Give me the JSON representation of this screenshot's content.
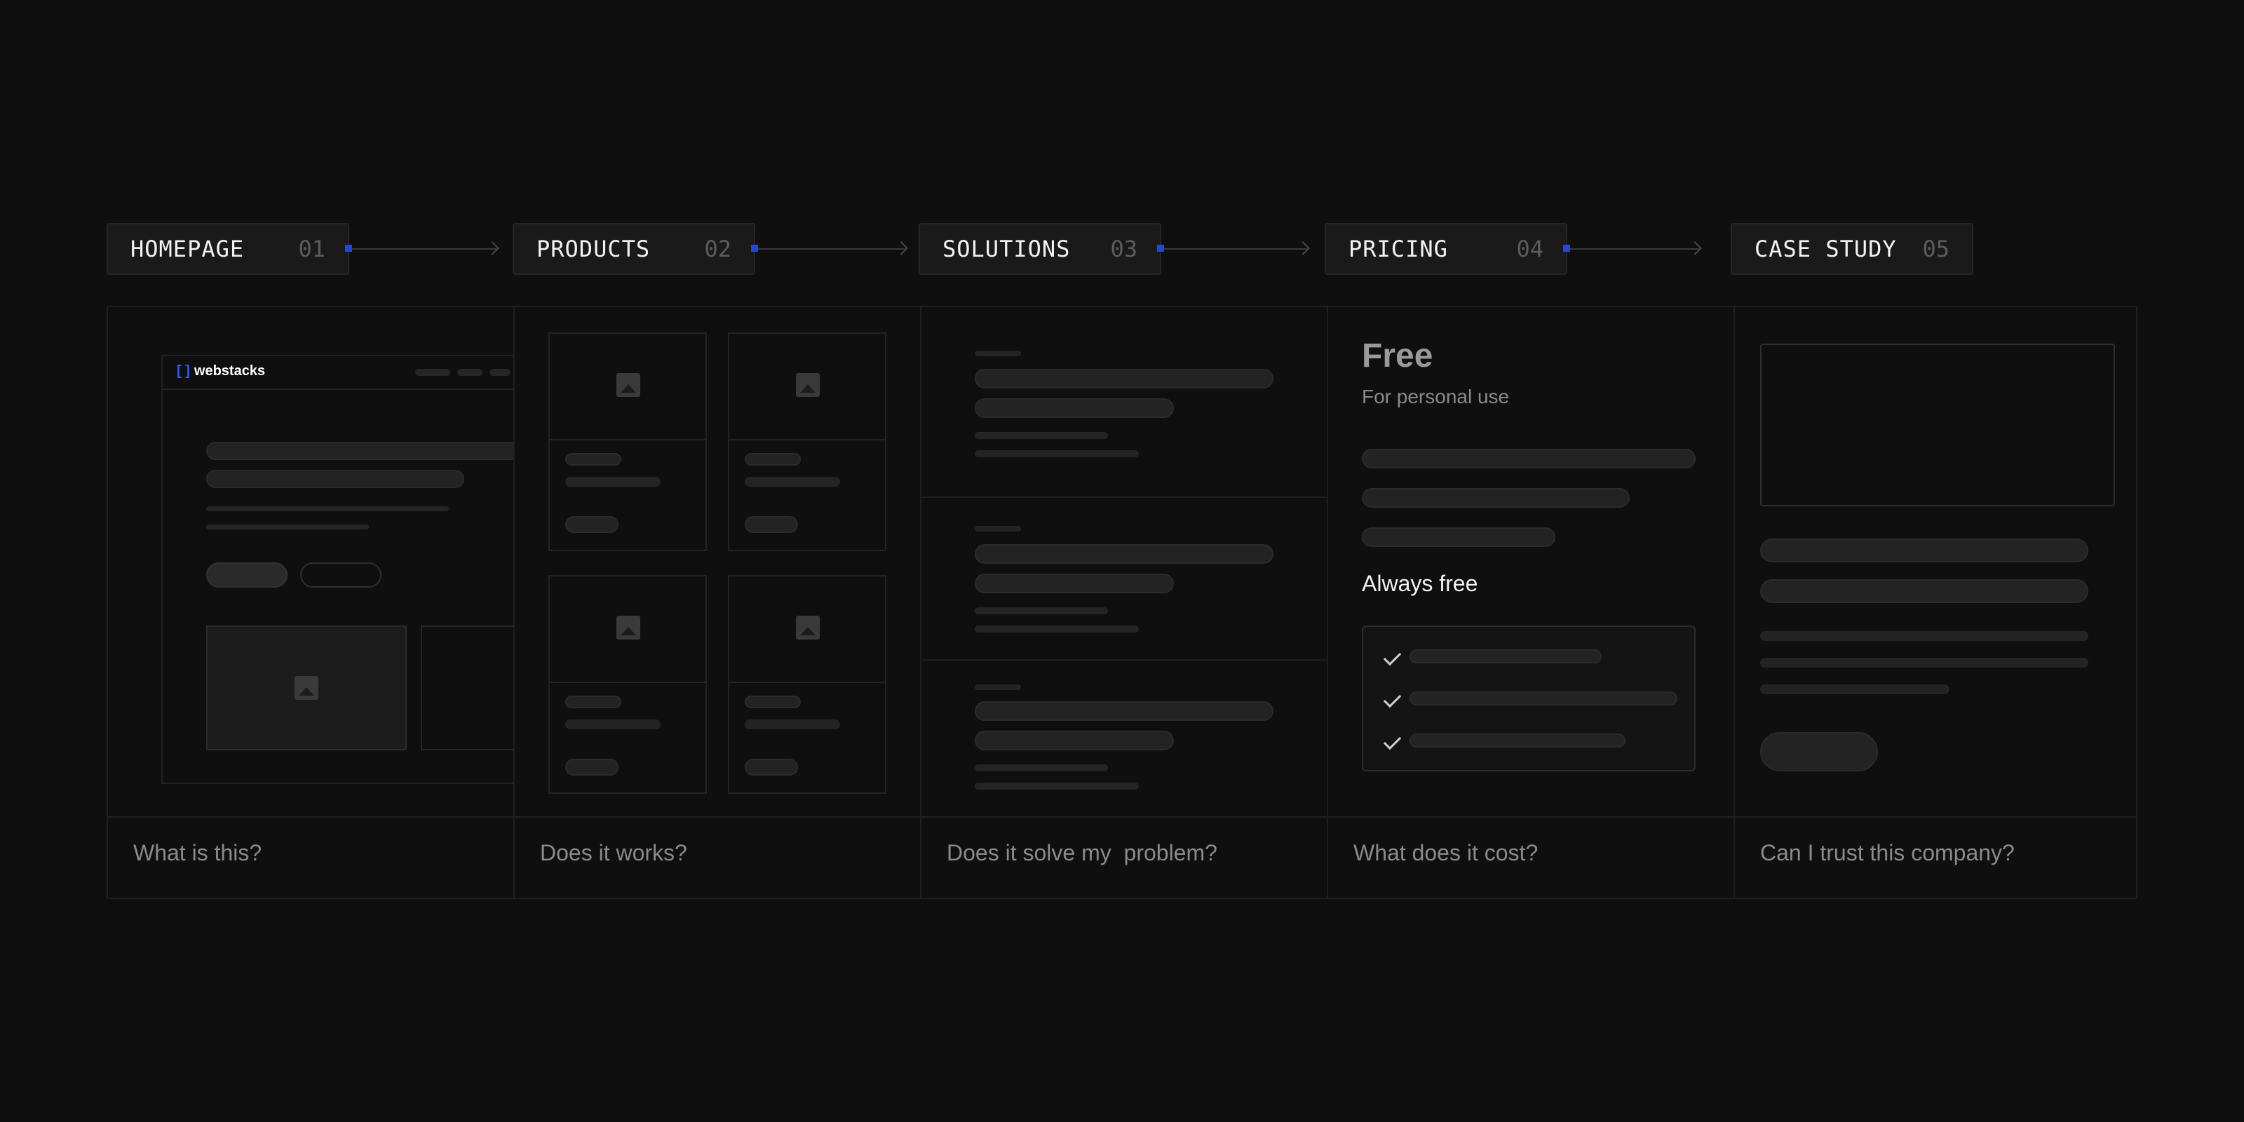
{
  "steps": [
    {
      "label": "HOMEPAGE",
      "num": "01"
    },
    {
      "label": "PRODUCTS",
      "num": "02"
    },
    {
      "label": "SOLUTIONS",
      "num": "03"
    },
    {
      "label": "PRICING",
      "num": "04"
    },
    {
      "label": "CASE STUDY",
      "num": "05"
    }
  ],
  "questions": {
    "homepage": "What is this?",
    "products": "Does it works?",
    "solutions": "Does it solve my  problem?",
    "pricing": "What does it cost?",
    "case_study": "Can I trust this company?"
  },
  "homepage_mock": {
    "logo_text": "webstacks",
    "logo_mark": "[ ]"
  },
  "pricing_mock": {
    "title": "Free",
    "subtitle": "For personal use",
    "always": "Always free"
  },
  "colors": {
    "accent": "#1f47e8",
    "background": "#0f0f0f"
  }
}
